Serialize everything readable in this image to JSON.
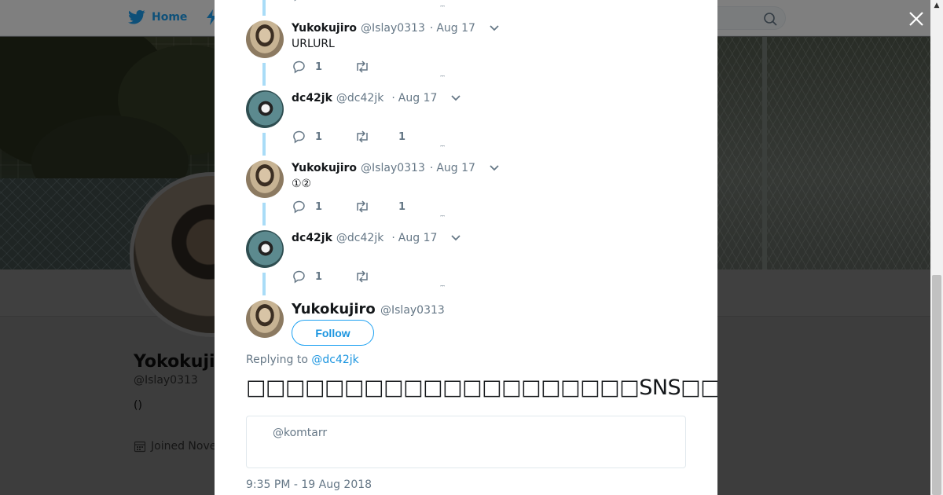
{
  "background": {
    "nav": {
      "home_label": "Home"
    },
    "profile": {
      "name": "Yokokuji",
      "handle": "@Islay0313",
      "bio": "()",
      "joined": "Joined Nove"
    }
  },
  "modal": {
    "thread": [
      {
        "author": "Yukokujiro",
        "handle": "@Islay0313",
        "dot": "·",
        "time": "Aug 17",
        "text": "URLURL",
        "replies": "1",
        "likes": ""
      },
      {
        "author": "dc42jk",
        "handle": "@dc42jk",
        "dot": "·",
        "time": "Aug 17",
        "text": "",
        "replies": "1",
        "likes": "1"
      },
      {
        "author": "Yukokujiro",
        "handle": "@Islay0313",
        "dot": "·",
        "time": "Aug 17",
        "text": "①②",
        "replies": "1",
        "likes": "1"
      },
      {
        "author": "dc42jk",
        "handle": "@dc42jk",
        "dot": "·",
        "time": "Aug 17",
        "text": "",
        "replies": "1",
        "likes": ""
      }
    ],
    "main_tweet": {
      "author": "Yukokujiro",
      "handle": "@Islay0313",
      "follow_label": "Follow",
      "replying_prefix": "Replying to",
      "replying_to": "@dc42jk",
      "text": "□□□□□□□□□□□□□□□□□□□□SNS□□□□□□□□□□□□□□□□",
      "quote": "@komtarr",
      "timestamp": "9:35 PM - 19 Aug 2018"
    }
  },
  "colors": {
    "accent": "#1da1f2",
    "link": "#1b95e0",
    "thread_line": "#a9dcf7",
    "secondary_text": "#657786"
  },
  "icons": [
    "twitter-bird-icon",
    "search-icon",
    "close-icon",
    "reply-icon",
    "retweet-icon",
    "chevron-down-icon",
    "calendar-icon"
  ]
}
